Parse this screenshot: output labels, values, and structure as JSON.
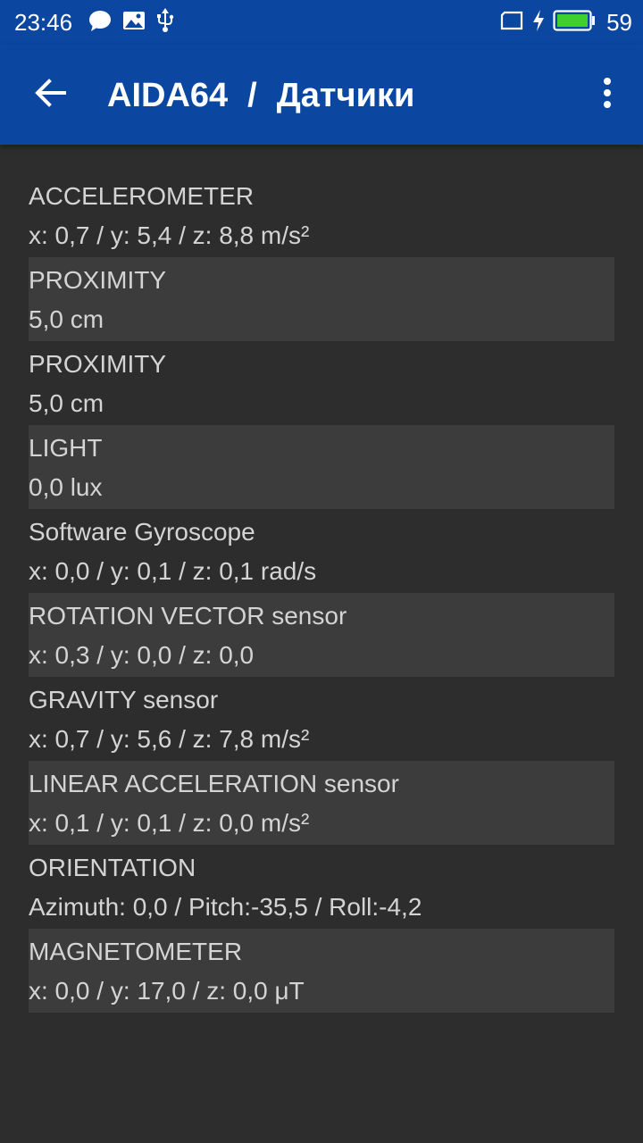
{
  "status_bar": {
    "time": "23:46",
    "battery_level": "59",
    "left_icons": [
      "chat-bubble-icon",
      "image-icon",
      "usb-icon"
    ],
    "right_icons": [
      "screen-icon",
      "charging-bolt-icon",
      "battery-icon"
    ]
  },
  "app_bar": {
    "app_name": "AIDA64",
    "separator": "/",
    "page_title": "Датчики",
    "back_icon": "arrow-left-icon",
    "menu_icon": "more-vertical-icon"
  },
  "colors": {
    "app_bar": "#0b47a1",
    "background": "#2d2d2d",
    "alt_row": "#3c3c3c",
    "text": "#d4d4d4",
    "battery_fill": "#3fcf2f"
  },
  "sensors": [
    {
      "label": "ACCELEROMETER",
      "value": "x: 0,7 / y: 5,4 / z: 8,8 m/s²"
    },
    {
      "label": "PROXIMITY",
      "value": "5,0 cm"
    },
    {
      "label": "PROXIMITY",
      "value": "5,0 cm"
    },
    {
      "label": "LIGHT",
      "value": "0,0 lux"
    },
    {
      "label": "Software Gyroscope",
      "value": "x: 0,0 / y: 0,1 / z: 0,1 rad/s"
    },
    {
      "label": "ROTATION VECTOR sensor",
      "value": "x: 0,3 / y: 0,0 / z: 0,0"
    },
    {
      "label": "GRAVITY sensor",
      "value": "x: 0,7 / y: 5,6 / z: 7,8 m/s²"
    },
    {
      "label": "LINEAR ACCELERATION sensor",
      "value": "x: 0,1 / y: 0,1 / z: 0,0 m/s²"
    },
    {
      "label": "ORIENTATION",
      "value": "Azimuth: 0,0 / Pitch:-35,5 / Roll:-4,2"
    },
    {
      "label": "MAGNETOMETER",
      "value": "x: 0,0 / y: 17,0 / z: 0,0 μT"
    }
  ]
}
